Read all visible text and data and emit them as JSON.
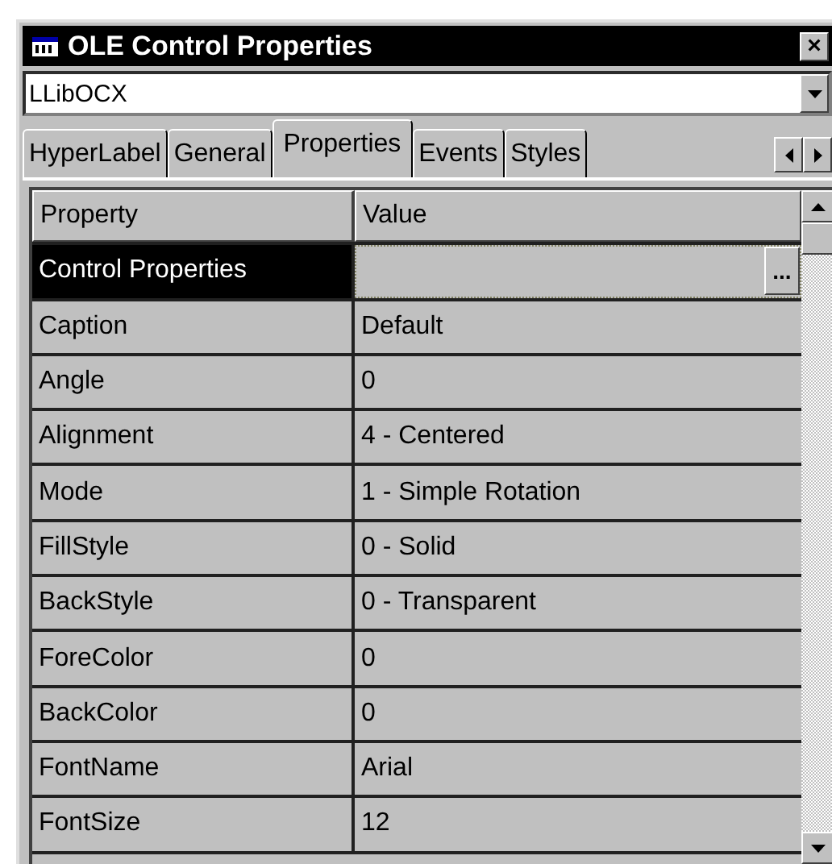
{
  "window": {
    "title": "OLE Control Properties",
    "close": "×"
  },
  "object_selector": {
    "value": "LLibOCX"
  },
  "tabs": [
    {
      "label": "HyperLabel",
      "selected": false
    },
    {
      "label": "General",
      "selected": false
    },
    {
      "label": "Properties",
      "selected": true
    },
    {
      "label": "Events",
      "selected": false
    },
    {
      "label": "Styles",
      "selected": false
    }
  ],
  "grid": {
    "columns": [
      "Property",
      "Value"
    ],
    "rows": [
      {
        "property": "Control Properties",
        "selected": true,
        "builder_button": "..."
      },
      {
        "property": "Caption",
        "value": "Default",
        "selected": false
      },
      {
        "property": "Angle",
        "value": "0",
        "selected": false
      },
      {
        "property": "Alignment",
        "value": "4 - Centered",
        "selected": false
      },
      {
        "property": "Mode",
        "value": "1 - Simple Rotation",
        "selected": false
      },
      {
        "property": "FillStyle",
        "value": "0 - Solid",
        "selected": false
      },
      {
        "property": "BackStyle",
        "value": "0 - Transparent",
        "selected": false
      },
      {
        "property": "ForeColor",
        "value": "0",
        "selected": false
      },
      {
        "property": "BackColor",
        "value": "0",
        "selected": false
      },
      {
        "property": "FontName",
        "value": "Arial",
        "selected": false
      },
      {
        "property": "FontSize",
        "value": "12",
        "selected": false
      }
    ]
  }
}
